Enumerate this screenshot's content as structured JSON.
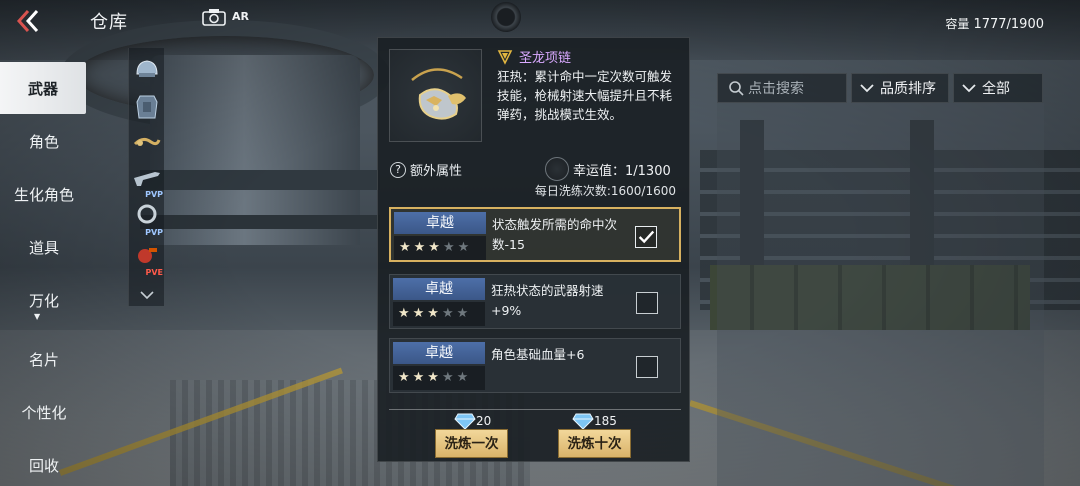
{
  "header": {
    "title": "仓库",
    "ar_label": "AR",
    "capacity_label": "容量",
    "capacity_value": "1777/1900"
  },
  "nav": {
    "items": [
      {
        "label": "武器",
        "active": true
      },
      {
        "label": "角色"
      },
      {
        "label": "生化角色"
      },
      {
        "label": "道具"
      },
      {
        "label": "万化"
      },
      {
        "label": "名片"
      },
      {
        "label": "个性化"
      },
      {
        "label": "回收"
      }
    ]
  },
  "thumbnails": [
    {
      "icon": "helmet-icon",
      "tag": ""
    },
    {
      "icon": "armor-icon",
      "tag": ""
    },
    {
      "icon": "dragon-necklace-icon",
      "tag": ""
    },
    {
      "icon": "rifle-icon",
      "tag": "PVP"
    },
    {
      "icon": "ring-icon",
      "tag": "PVP"
    },
    {
      "icon": "grenade-icon",
      "tag": "PVE"
    }
  ],
  "toolbar": {
    "search_placeholder": "点击搜索",
    "sort_label": "品质排序",
    "filter_label": "全部"
  },
  "item": {
    "name": "圣龙项链",
    "name_color": "#d9a9ff",
    "description": "狂热：累计命中一定次数可触发技能，枪械射速大幅提升且不耗弹药，挑战模式生效。"
  },
  "extra": {
    "label": "额外属性",
    "luck": "幸运值：1/1300",
    "daily": "每日洗练次数:1600/1600"
  },
  "attributes": [
    {
      "grade": "卓越",
      "stars": 3,
      "max_stars": 5,
      "text": "状态触发所需的命中次数-15",
      "checked": true
    },
    {
      "grade": "卓越",
      "stars": 3,
      "max_stars": 5,
      "text": "狂热状态的武器射速+9%",
      "checked": false
    },
    {
      "grade": "卓越",
      "stars": 3,
      "max_stars": 5,
      "text": "角色基础血量+6",
      "checked": false
    }
  ],
  "refine": {
    "once_cost": "20",
    "once_label": "洗炼一次",
    "ten_cost": "185",
    "ten_label": "洗炼十次"
  },
  "colors": {
    "accent_gold": "#d7b160",
    "grade_blue": "#4d6fa8",
    "button_gold": "#e6c47f"
  }
}
